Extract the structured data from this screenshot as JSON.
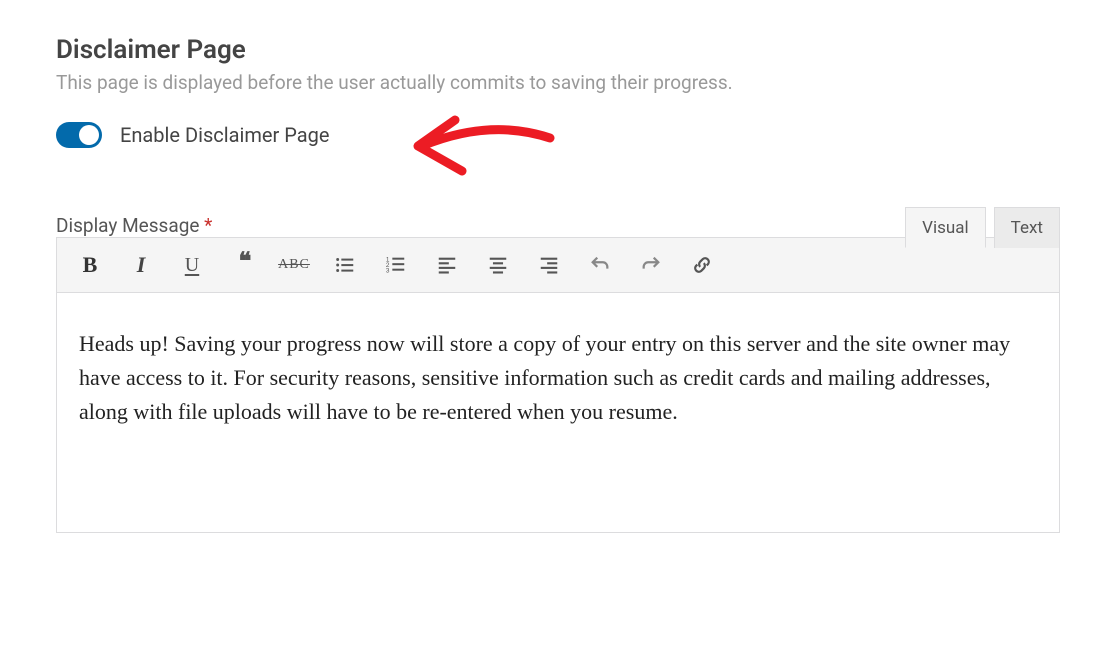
{
  "section": {
    "title": "Disclaimer Page",
    "description": "This page is displayed before the user actually commits to saving their progress."
  },
  "toggle": {
    "label": "Enable Disclaimer Page",
    "enabled": true
  },
  "field": {
    "label": "Display Message",
    "required_mark": "*"
  },
  "tabs": {
    "visual": "Visual",
    "text": "Text",
    "active": "visual"
  },
  "toolbar": {
    "bold": "B",
    "italic": "I",
    "underline": "U",
    "strike": "ABC"
  },
  "editor": {
    "content": "Heads up! Saving your progress now will store a copy of your entry on this server and the site owner may have access to it. For security reasons, sensitive information such as credit cards and mailing addresses, along with file uploads will have to be re-entered when you resume."
  },
  "annotation": {
    "name": "arrow-pointing-to-toggle"
  }
}
